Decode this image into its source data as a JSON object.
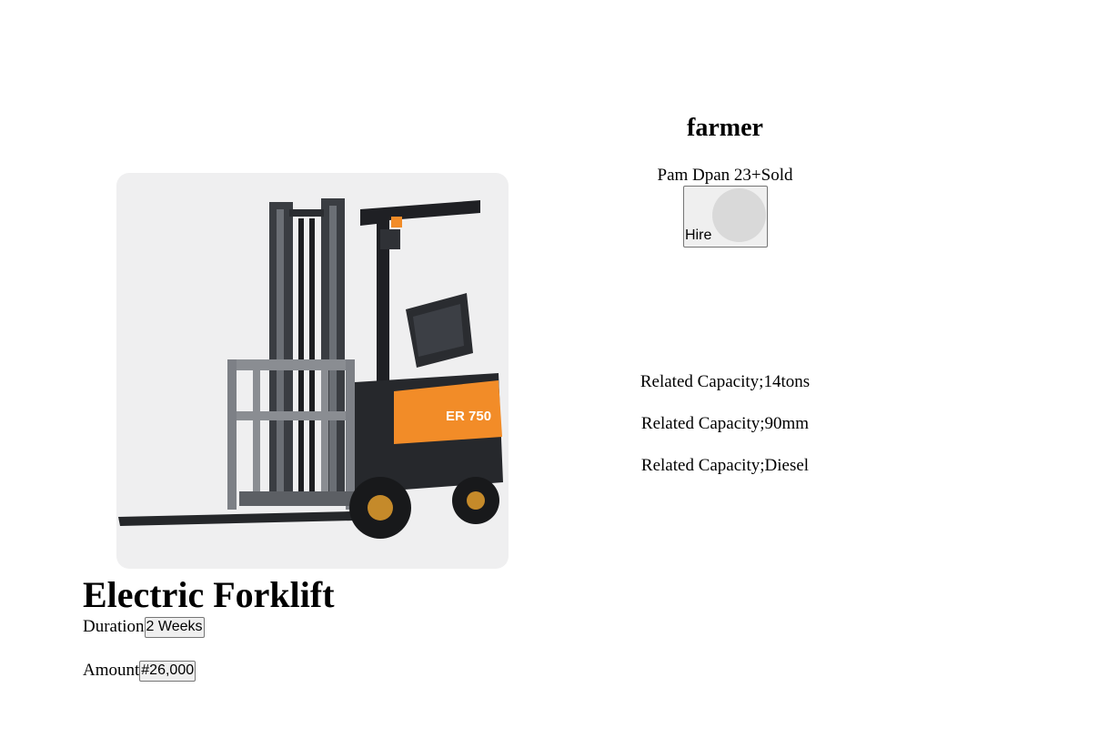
{
  "product": {
    "title": "Electric Forklift",
    "image_icon": "forklift-image",
    "duration_label": "Duration",
    "duration_value": "2 Weeks",
    "amount_label": "Amount",
    "amount_value": "#26,000"
  },
  "seller": {
    "name": "farmer",
    "sales_text": "Pam Dpan 23+Sold",
    "hire_label": "Hire"
  },
  "specs": [
    "Related Capacity;14tons",
    "Related Capacity;90mm",
    "Related Capacity;Diesel"
  ],
  "colors": {
    "image_bg": "#efeff0",
    "button_bg": "#efefef",
    "avatar": "#d9d9d9",
    "accent_orange": "#f28c28"
  }
}
